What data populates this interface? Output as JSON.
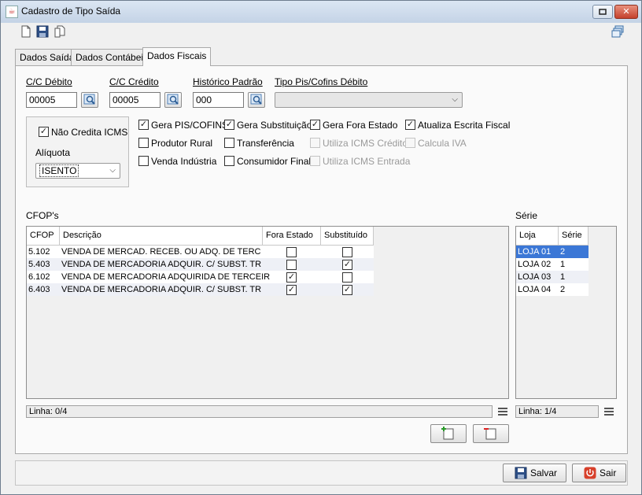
{
  "window": {
    "title": "Cadastro de Tipo Saída"
  },
  "tabs": [
    {
      "label": "Dados Saída"
    },
    {
      "label": "Dados Contábeis"
    },
    {
      "label": "Dados Fiscais",
      "active": true
    }
  ],
  "fields": {
    "cc_debito": {
      "label": "C/C Débito",
      "value": "00005"
    },
    "cc_credito": {
      "label": "C/C Crédito",
      "value": "00005"
    },
    "historico": {
      "label": "Histórico Padrão",
      "value": "000"
    },
    "tipo_pis": {
      "label": "Tipo Pis/Cofins Débito",
      "value": ""
    }
  },
  "icms_group": {
    "nao_credita_label": "Não Credita ICMS",
    "nao_credita_checked": true,
    "aliquota_label": "Alíquota",
    "aliquota_value": "ISENTO"
  },
  "options": [
    {
      "label": "Gera PIS/COFINS",
      "checked": true,
      "enabled": true
    },
    {
      "label": "Gera Substituição",
      "checked": true,
      "enabled": true
    },
    {
      "label": "Gera Fora Estado",
      "checked": true,
      "enabled": true
    },
    {
      "label": "Atualiza Escrita Fiscal",
      "checked": true,
      "enabled": true
    },
    {
      "label": "Produtor Rural",
      "checked": false,
      "enabled": true
    },
    {
      "label": "Transferência",
      "checked": false,
      "enabled": true
    },
    {
      "label": "Utiliza ICMS Crédito",
      "checked": false,
      "enabled": false
    },
    {
      "label": "Calcula IVA",
      "checked": false,
      "enabled": false
    },
    {
      "label": "Venda Indústria",
      "checked": false,
      "enabled": true
    },
    {
      "label": "Consumidor Final",
      "checked": false,
      "enabled": true
    },
    {
      "label": "Utiliza ICMS Entrada",
      "checked": false,
      "enabled": false
    }
  ],
  "cfops": {
    "title": "CFOP's",
    "columns": [
      "CFOP",
      "Descrição",
      "Fora Estado",
      "Substituído"
    ],
    "rows": [
      {
        "cfop": "5.102",
        "descricao": "VENDA DE MERCAD. RECEB. OU ADQ. DE TERC",
        "fora_estado": false,
        "substituido": false
      },
      {
        "cfop": "5.403",
        "descricao": "VENDA DE MERCADORIA ADQUIR. C/ SUBST. TR",
        "fora_estado": false,
        "substituido": true
      },
      {
        "cfop": "6.102",
        "descricao": "VENDA DE MERCADORIA ADQUIRIDA DE TERCEIR",
        "fora_estado": true,
        "substituido": false
      },
      {
        "cfop": "6.403",
        "descricao": "VENDA DE MERCADORIA ADQUIR. C/ SUBST. TR",
        "fora_estado": true,
        "substituido": true
      }
    ],
    "status": "Linha: 0/4"
  },
  "serie": {
    "title": "Série",
    "columns": [
      "Loja",
      "Série"
    ],
    "rows": [
      {
        "loja": "LOJA 01",
        "serie": "2",
        "selected": true
      },
      {
        "loja": "LOJA 02",
        "serie": "1",
        "selected": false
      },
      {
        "loja": "LOJA 03",
        "serie": "1",
        "selected": false
      },
      {
        "loja": "LOJA 04",
        "serie": "2",
        "selected": false
      }
    ],
    "status": "Linha: 1/4"
  },
  "buttons": {
    "salvar": "Salvar",
    "sair": "Sair"
  },
  "colors": {
    "selection": "#3b77d6",
    "close_red": "#c4412c"
  }
}
